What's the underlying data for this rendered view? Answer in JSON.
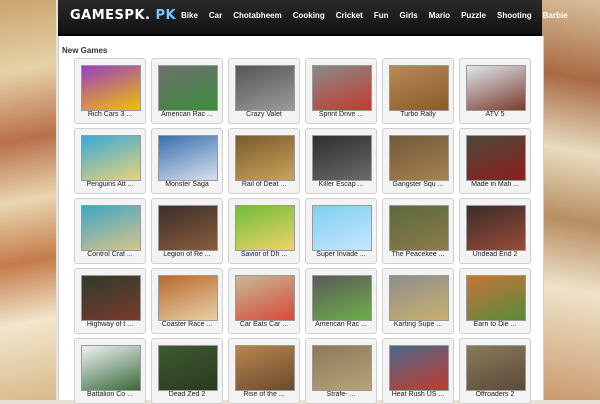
{
  "site": {
    "logo_main": "GAMESPK.",
    "logo_suffix": "PK"
  },
  "nav": [
    "Bike",
    "Car",
    "Chotabheem",
    "Cooking",
    "Cricket",
    "Fun",
    "Girls",
    "Mario",
    "Puzzle",
    "Shooting",
    "Barbie"
  ],
  "section_title": "New Games",
  "games": [
    {
      "title": "Rich Cars 3 ...",
      "colors": [
        "#9b3cc7",
        "#f0c200"
      ]
    },
    {
      "title": "American Rac ...",
      "colors": [
        "#6f6f6f",
        "#3c8c3a"
      ]
    },
    {
      "title": "Crazy Valet",
      "colors": [
        "#555555",
        "#9b9b9b"
      ]
    },
    {
      "title": "Sprint Drive ...",
      "colors": [
        "#8a8a8a",
        "#c23b2b"
      ]
    },
    {
      "title": "Turbo Rally",
      "colors": [
        "#b88a56",
        "#8b5a2b"
      ]
    },
    {
      "title": "ATV 5",
      "colors": [
        "#dfe6ea",
        "#7a3b2e"
      ]
    },
    {
      "title": "Penguins Att ...",
      "colors": [
        "#3aa9d6",
        "#e8d37a"
      ]
    },
    {
      "title": "Monster Saga",
      "colors": [
        "#3b6fb0",
        "#d6e0ef"
      ]
    },
    {
      "title": "Rail of Deat ...",
      "colors": [
        "#7a5a2e",
        "#c9a45a"
      ]
    },
    {
      "title": "Killer Escap ...",
      "colors": [
        "#2e2e2e",
        "#6a6a6a"
      ]
    },
    {
      "title": "Gangster Squ ...",
      "colors": [
        "#6e5a3c",
        "#a8824e"
      ]
    },
    {
      "title": "Made in Mafi ...",
      "colors": [
        "#4a4a3a",
        "#8e1e1e"
      ]
    },
    {
      "title": "Control Craf ...",
      "colors": [
        "#3fa6c6",
        "#d8c48a"
      ]
    },
    {
      "title": "Legion of Re ...",
      "colors": [
        "#3b2f2a",
        "#8a5c3e"
      ]
    },
    {
      "title": "Savior of Dh ...",
      "colors": [
        "#6fbe3a",
        "#f0d36a"
      ]
    },
    {
      "title": "Super Invade ...",
      "colors": [
        "#7fd0f0",
        "#c6e6ff"
      ]
    },
    {
      "title": "The Peacekee ...",
      "colors": [
        "#5a6a3a",
        "#8e7a4e"
      ]
    },
    {
      "title": "Undead End 2",
      "colors": [
        "#3a2e28",
        "#9a4a3a"
      ]
    },
    {
      "title": "Highway of t ...",
      "colors": [
        "#2e3b2a",
        "#7a3b2e"
      ]
    },
    {
      "title": "Coaster Race ...",
      "colors": [
        "#b86a2e",
        "#e8d0a6"
      ]
    },
    {
      "title": "Car Eats Car ...",
      "colors": [
        "#c8b896",
        "#d64a3a"
      ]
    },
    {
      "title": "American Rac ...",
      "colors": [
        "#5a5a5a",
        "#6fae4a"
      ]
    },
    {
      "title": "Karting Supe ...",
      "colors": [
        "#8e8e8e",
        "#c8b06e"
      ]
    },
    {
      "title": "Earn to Die ...",
      "colors": [
        "#c4753a",
        "#5a8a3a"
      ]
    },
    {
      "title": "Battalion Co ...",
      "colors": [
        "#eef2f4",
        "#3a6a3a"
      ]
    },
    {
      "title": "Dead Zed 2",
      "colors": [
        "#3e5a2e",
        "#2a3a22"
      ]
    },
    {
      "title": "Rise of the ...",
      "colors": [
        "#b8864e",
        "#6a4a2e"
      ]
    },
    {
      "title": "Strafe- ...",
      "colors": [
        "#8a7a5a",
        "#b8a47a"
      ]
    },
    {
      "title": "Heat Rush US ...",
      "colors": [
        "#4a6a8a",
        "#c43a2e"
      ]
    },
    {
      "title": "Offroaders 2",
      "colors": [
        "#8a7a5a",
        "#5a4a3a"
      ]
    }
  ]
}
